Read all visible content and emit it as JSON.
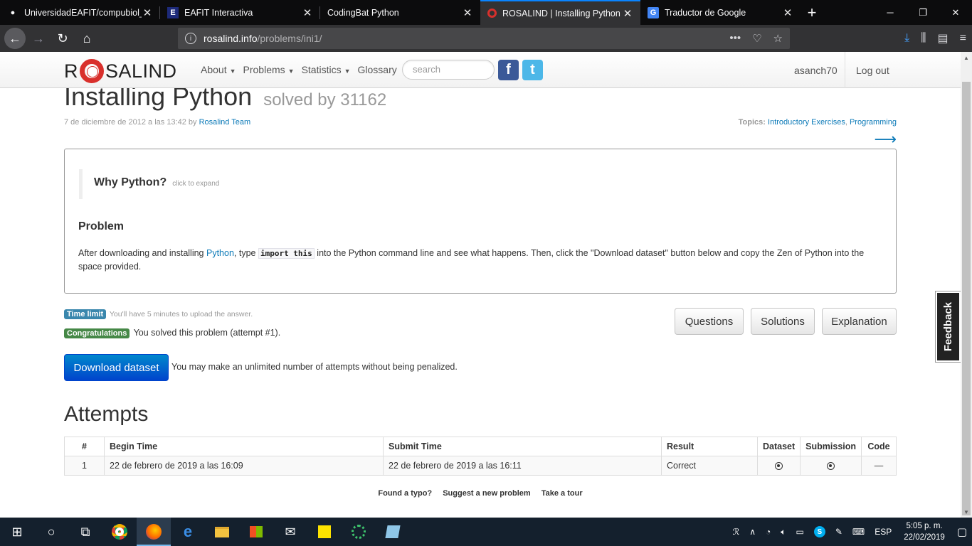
{
  "browser": {
    "tabs": [
      {
        "label": "UniversidadEAFIT/compubiol_c",
        "icon": "github-icon",
        "active": false
      },
      {
        "label": "EAFIT Interactiva",
        "icon": "eafit-icon",
        "active": false
      },
      {
        "label": "CodingBat Python",
        "icon": "",
        "active": false
      },
      {
        "label": "ROSALIND | Installing Python",
        "icon": "rosalind-icon",
        "active": true
      },
      {
        "label": "Traductor de Google",
        "icon": "google-translate-icon",
        "active": false
      }
    ],
    "url_host": "rosalind.info",
    "url_path": "/problems/ini1/"
  },
  "site": {
    "logo_left": "R",
    "logo_right": "SALIND",
    "menu": [
      {
        "label": "About"
      },
      {
        "label": "Problems"
      },
      {
        "label": "Statistics"
      },
      {
        "label": "Glossary"
      }
    ],
    "search_placeholder": "search",
    "username": "asanch70",
    "logout": "Log out"
  },
  "problem": {
    "title": "Installing Python",
    "solved_by": "solved by 31162",
    "date": "7 de diciembre de 2012 a las 13:42 by ",
    "author": "Rosalind Team",
    "topics_label": "Topics:",
    "topics": [
      "Introductory Exercises",
      "Programming"
    ],
    "why_heading": "Why Python?",
    "why_hint": "click to expand",
    "problem_heading": "Problem",
    "text_before_link": "After downloading and installing ",
    "link": "Python",
    "text_mid": ", type ",
    "code": "import this",
    "text_after": " into the Python command line and see what happens. Then, click the \"Download dataset\" button below and copy the Zen of Python into the space provided."
  },
  "status": {
    "time_badge": "Time limit",
    "time_text": "You'll have 5 minutes to upload the answer.",
    "congrats_badge": "Congratulations",
    "congrats_text": "You solved this problem (attempt #1)."
  },
  "buttons": {
    "questions": "Questions",
    "solutions": "Solutions",
    "explanation": "Explanation",
    "download": "Download dataset",
    "download_note": "You may make an unlimited number of attempts without being penalized."
  },
  "attempts": {
    "heading": "Attempts",
    "columns": [
      "#",
      "Begin Time",
      "Submit Time",
      "Result",
      "Dataset",
      "Submission",
      "Code"
    ],
    "rows": [
      {
        "num": "1",
        "begin": "22 de febrero de 2019 a las 16:09",
        "submit": "22 de febrero de 2019 a las 16:11",
        "result": "Correct",
        "code": "—"
      }
    ]
  },
  "footer": [
    "Found a typo?",
    "Suggest a new problem",
    "Take a tour"
  ],
  "feedback": "Feedback",
  "taskbar": {
    "lang": "ESP",
    "time": "5:05 p. m.",
    "date": "22/02/2019"
  }
}
